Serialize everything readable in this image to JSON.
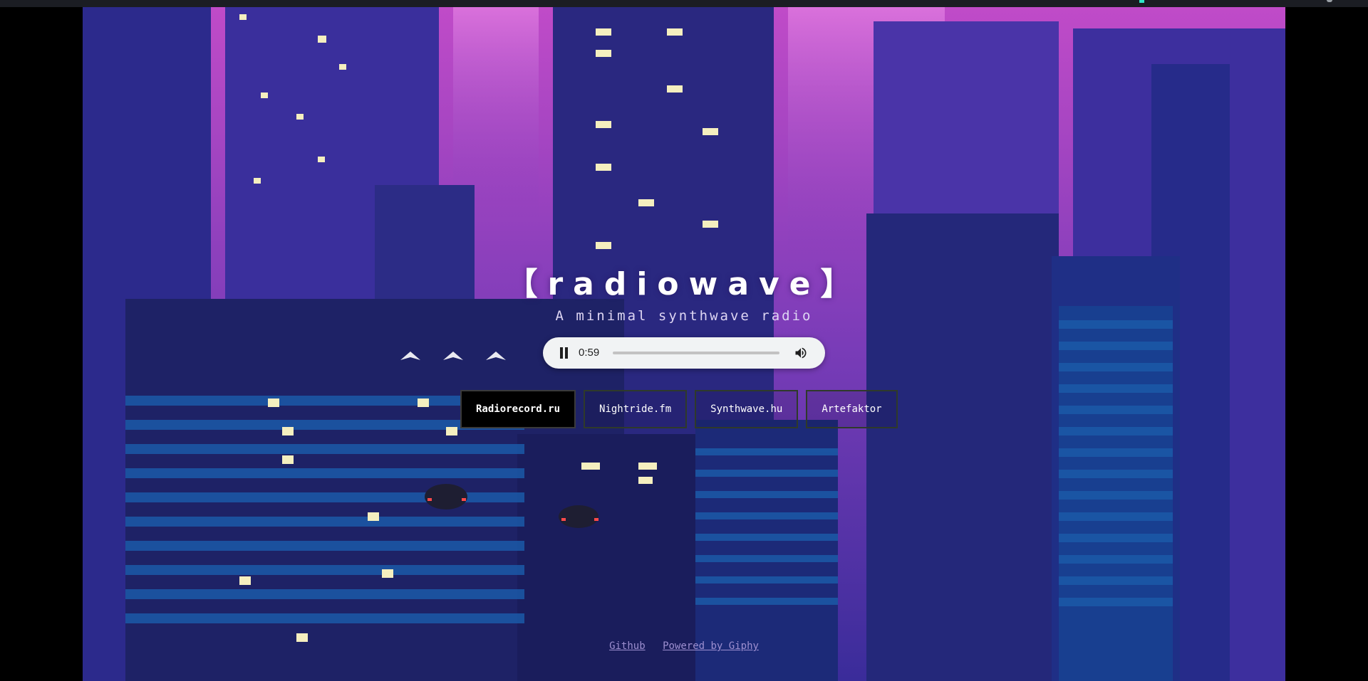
{
  "app": {
    "title": "【radiowave】",
    "tagline": "A minimal synthwave radio"
  },
  "player": {
    "state": "playing",
    "time": "0:59",
    "progress": 0.0
  },
  "stations": [
    {
      "label": "Radiorecord.ru",
      "active": true
    },
    {
      "label": "Nightride.fm",
      "active": false
    },
    {
      "label": "Synthwave.hu",
      "active": false
    },
    {
      "label": "Artefaktor",
      "active": false
    }
  ],
  "footer": {
    "links": [
      {
        "label": "Github"
      },
      {
        "label": "Powered by Giphy"
      }
    ]
  },
  "colors": {
    "accent_sky": "#b34fd0",
    "accent_buildings": "#2a2a8e",
    "window_light": "#f6f0c0",
    "footer_link": "#9d8fd0"
  },
  "background": {
    "description_icon": "city-skyline-gif"
  }
}
